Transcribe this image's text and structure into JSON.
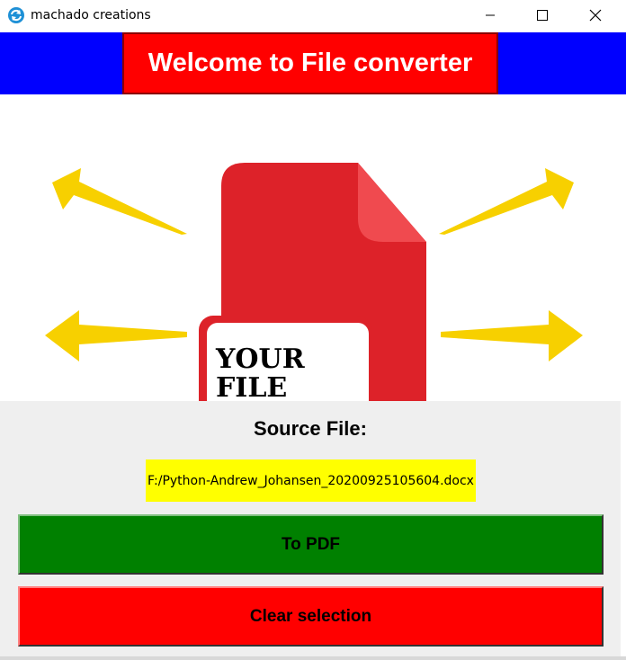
{
  "window": {
    "title": "machado creations",
    "icon": "refresh-icon",
    "controls": [
      "minimize-icon",
      "maximize-icon",
      "close-icon"
    ]
  },
  "header": {
    "title": "Welcome to File converter",
    "bg_color": "#0000ff",
    "title_bg_color": "#ff0000"
  },
  "illustration": {
    "file_text_line1": "YOUR",
    "file_text_line2": "FILE"
  },
  "main": {
    "source_label": "Source File:",
    "source_path": "F:/Python-Andrew_Johansen_20200925105604.docx",
    "to_pdf_label": "To PDF",
    "clear_label": "Clear selection",
    "colors": {
      "path_bg": "#ffff00",
      "to_pdf_bg": "#008000",
      "clear_bg": "#ff0000"
    }
  }
}
